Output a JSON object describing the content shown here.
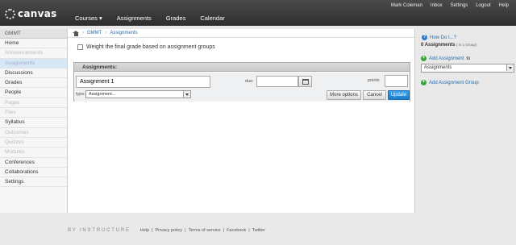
{
  "header": {
    "logo_text": "canvas",
    "nav": [
      "Courses ▾",
      "Assignments",
      "Grades",
      "Calendar"
    ],
    "user_nav": [
      "Mark Coleman",
      "Inbox",
      "Settings",
      "Logout",
      "Help"
    ]
  },
  "sidebar": {
    "course_code": "GMMT",
    "items": [
      {
        "label": "Home",
        "state": "enabled"
      },
      {
        "label": "Announcements",
        "state": "disabled"
      },
      {
        "label": "Assignments",
        "state": "active"
      },
      {
        "label": "Discussions",
        "state": "enabled"
      },
      {
        "label": "Grades",
        "state": "enabled"
      },
      {
        "label": "People",
        "state": "enabled"
      },
      {
        "label": "Pages",
        "state": "disabled"
      },
      {
        "label": "Files",
        "state": "disabled"
      },
      {
        "label": "Syllabus",
        "state": "enabled"
      },
      {
        "label": "Outcomes",
        "state": "disabled"
      },
      {
        "label": "Quizzes",
        "state": "disabled"
      },
      {
        "label": "Modules",
        "state": "disabled"
      },
      {
        "label": "Conferences",
        "state": "enabled"
      },
      {
        "label": "Collaborations",
        "state": "enabled"
      },
      {
        "label": "Settings",
        "state": "enabled"
      }
    ]
  },
  "breadcrumb": [
    "GMMT",
    "Assignments"
  ],
  "main": {
    "weight_label": "Weight the final grade based on assignment groups",
    "group_title": "Assignments:",
    "form": {
      "title_value": "Assignment 1",
      "due_label": "due:",
      "points_label": "points",
      "type_label": "type:",
      "type_value": "Assignment...",
      "more_options": "More options",
      "cancel": "Cancel",
      "update": "Update"
    }
  },
  "right": {
    "how_do_i": "How Do I...?",
    "count_bold": "0 Assignments",
    "count_small": "( in 1 Group)",
    "add_assignment": "Add Assignment",
    "add_assignment_to": "to",
    "group_select_value": "Assignments",
    "add_group": "Add Assignment Group"
  },
  "footer": {
    "brand": "BY INSTRUCTURE",
    "links": [
      "Help",
      "|",
      "Privacy policy",
      "|",
      "Terms of service",
      "|",
      "Facebook",
      "|",
      "Twitter"
    ]
  },
  "colors": {
    "header_bg": "#3a3a3a",
    "link": "#2a6ba8",
    "primary_button": "#2a8ad8",
    "active_nav_bg": "#d6e8f6"
  }
}
